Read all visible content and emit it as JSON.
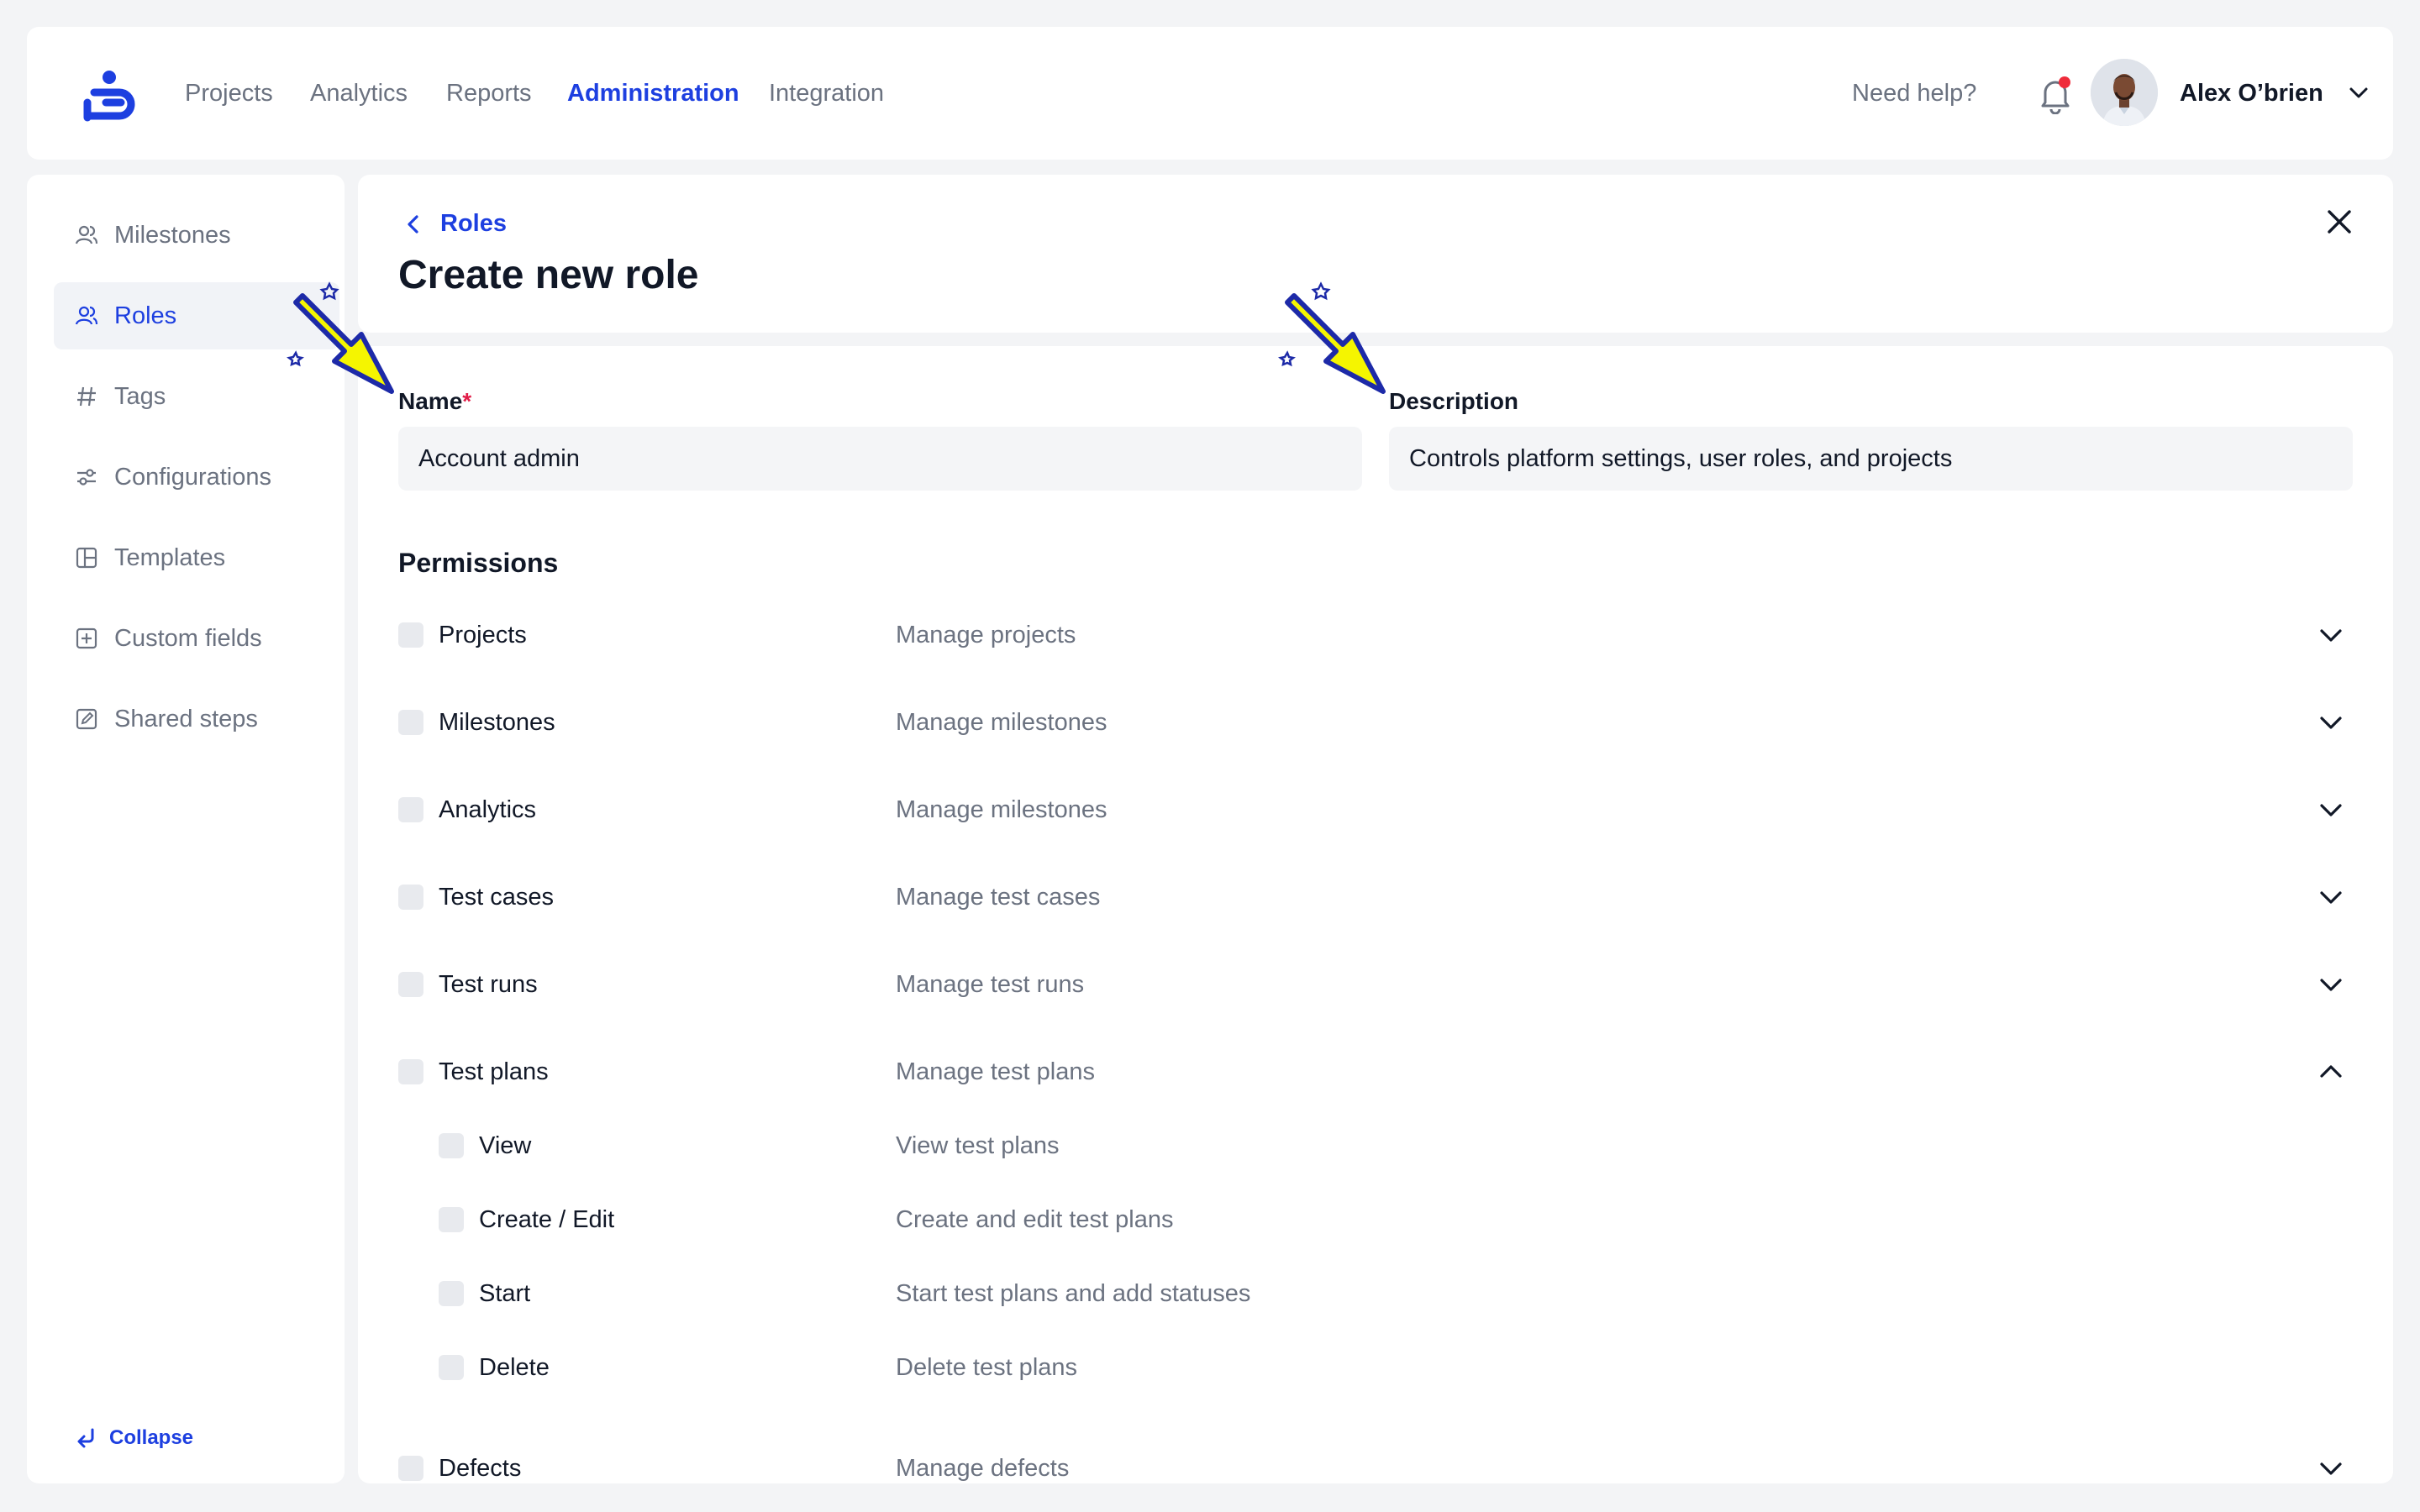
{
  "nav": {
    "items": [
      "Projects",
      "Analytics",
      "Reports",
      "Administration",
      "Integration"
    ],
    "active": "Administration",
    "help": "Need help?",
    "user_name": "Alex O’brien"
  },
  "sidebar": {
    "items": [
      "Milestones",
      "Roles",
      "Tags",
      "Configurations",
      "Templates",
      "Custom fields",
      "Shared steps"
    ],
    "active": "Roles",
    "collapse": "Collapse"
  },
  "header": {
    "back": "Roles",
    "title": "Create new role"
  },
  "form": {
    "name_label": "Name",
    "name_required": "*",
    "name_value": "Account admin",
    "description_label": "Description",
    "description_value": "Controls platform settings, user roles, and projects"
  },
  "permissions": {
    "heading": "Permissions",
    "rows": [
      {
        "name": "Projects",
        "description": "Manage projects",
        "expanded": false
      },
      {
        "name": "Milestones",
        "description": "Manage milestones",
        "expanded": false
      },
      {
        "name": "Analytics",
        "description": "Manage milestones",
        "expanded": false
      },
      {
        "name": "Test cases",
        "description": "Manage test cases",
        "expanded": false
      },
      {
        "name": "Test runs",
        "description": "Manage test runs",
        "expanded": false
      },
      {
        "name": "Test plans",
        "description": "Manage test plans",
        "expanded": true
      },
      {
        "name": "Defects",
        "description": "Manage defects",
        "expanded": false
      }
    ],
    "test_plans_children": [
      {
        "name": "View",
        "description": "View test plans"
      },
      {
        "name": "Create / Edit",
        "description": "Create and edit test plans"
      },
      {
        "name": "Start",
        "description": "Start test plans and add statuses"
      },
      {
        "name": "Delete",
        "description": "Delete test plans"
      }
    ]
  },
  "colors": {
    "accent": "#1d3fe0",
    "page_bg": "#f3f4f6",
    "notification_dot": "#ef2b3a",
    "highlight_arrow": "#f5f500"
  }
}
